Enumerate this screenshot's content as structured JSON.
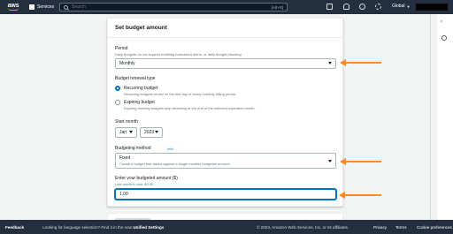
{
  "topnav": {
    "logo_text": "aws",
    "services_label": "Services",
    "search_placeholder": "Search",
    "search_shortcut": "[Alt+S]",
    "region_label": "Global",
    "icons": [
      "cloudshell-icon",
      "notifications-icon",
      "help-icon",
      "settings-icon"
    ]
  },
  "card": {
    "title": "Set budget amount",
    "period": {
      "label": "Period",
      "description": "Daily budgets do not support enabling forecasted alerts, or daily budget planning.",
      "value": "Monthly"
    },
    "renewal": {
      "label": "Budget renewal type",
      "options": [
        {
          "label": "Recurring budget",
          "description": "Recurring budgets renew on the first day of every monthly billing period.",
          "checked": true
        },
        {
          "label": "Expiring budget",
          "description": "Expiring monthly budgets stop renewing at the end of the selected expiration month.",
          "checked": false
        }
      ]
    },
    "start_month": {
      "label": "Start month",
      "month": "Jan",
      "year": "2023"
    },
    "method": {
      "label": "Budgeting method",
      "info": "Info",
      "value": "Fixed",
      "description": "Create a budget that tracks against a single monthly budgeted amount."
    },
    "amount": {
      "label": "Enter your budgeted amount ($)",
      "hint": "Last month's cost: $0.00",
      "value": "1.00"
    }
  },
  "footer": {
    "feedback": "Feedback",
    "language_prefix": "Looking for language selection? Find it in the new ",
    "language_link": "Unified Settings",
    "copyright": "© 2023, Amazon Web Services, Inc. or its affiliates.",
    "privacy": "Privacy",
    "terms": "Terms",
    "cookie": "Cookie preferences"
  },
  "colors": {
    "nav_bg": "#232f3e",
    "accent": "#0073bb",
    "annotation_arrow": "#ff8a1f"
  }
}
